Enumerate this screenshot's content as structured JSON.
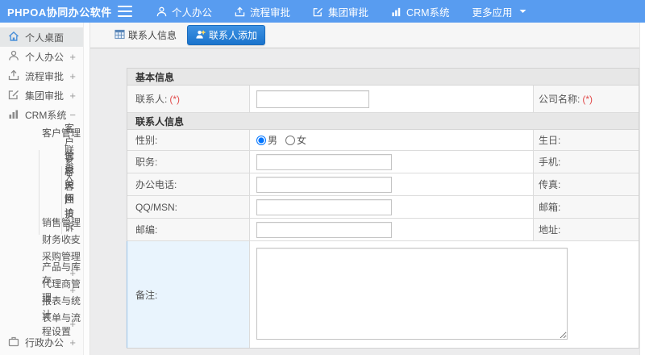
{
  "colors": {
    "topbar_blue": "#589cf0",
    "active_tab_blue": "#1b74cc",
    "required_red": "#e24c4c",
    "highlight_row": "#e9f4fd",
    "selected_sidebar": "#e5e7e8"
  },
  "topbar": {
    "brand": "PHPOA协同办公软件",
    "menu": [
      {
        "label": "个人办公",
        "icon": "user-icon"
      },
      {
        "label": "流程审批",
        "icon": "approval-icon"
      },
      {
        "label": "集团审批",
        "icon": "edit-icon"
      },
      {
        "label": "CRM系统",
        "icon": "chart-icon"
      },
      {
        "label": "更多应用",
        "icon": "caret-down-icon"
      }
    ]
  },
  "sidebar": {
    "items": [
      {
        "label": "个人桌面",
        "icon": "home-icon",
        "depth": 0,
        "selected": true,
        "toggle": ""
      },
      {
        "label": "个人办公",
        "icon": "user-icon",
        "depth": 0,
        "toggle": "+"
      },
      {
        "label": "流程审批",
        "icon": "approval-icon",
        "depth": 0,
        "toggle": "+"
      },
      {
        "label": "集团审批",
        "icon": "edit-icon",
        "depth": 0,
        "toggle": "+"
      },
      {
        "label": "CRM系统",
        "icon": "chart-icon",
        "depth": 0,
        "toggle": "−"
      },
      {
        "label": "客户管理",
        "depth": 1,
        "toggle": "−"
      },
      {
        "label": "客户信息",
        "depth": 2,
        "toggle": ""
      },
      {
        "label": "联系人",
        "depth": 2,
        "toggle": ""
      },
      {
        "label": "客户关怀",
        "depth": 2,
        "toggle": ""
      },
      {
        "label": "客户回访",
        "depth": 2,
        "toggle": ""
      },
      {
        "label": "客户投诉",
        "depth": 2,
        "toggle": ""
      },
      {
        "label": "销售管理",
        "depth": 1,
        "toggle": "+"
      },
      {
        "label": "财务收支",
        "depth": 1,
        "toggle": "+"
      },
      {
        "label": "采购管理",
        "depth": 1,
        "toggle": "+"
      },
      {
        "label": "产品与库存",
        "depth": 1,
        "toggle": "+"
      },
      {
        "label": "代理商管理",
        "depth": 1,
        "toggle": "+"
      },
      {
        "label": "报表与统计",
        "depth": 1,
        "toggle": ""
      },
      {
        "label": "表单与流程设置",
        "depth": 1,
        "toggle": "+"
      },
      {
        "label": "行政办公",
        "icon": "briefcase-icon",
        "depth": 0,
        "toggle": "+"
      }
    ]
  },
  "tabs": [
    {
      "label": "联系人信息",
      "icon": "grid-icon",
      "active": false
    },
    {
      "label": "联系人添加",
      "icon": "add-contact-icon",
      "active": true
    }
  ],
  "form": {
    "section1_title": "基本信息",
    "section2_title": "联系人信息",
    "row_contact": {
      "left": "联系人:",
      "left_req": "(*)",
      "right": "公司名称:",
      "right_req": "(*)",
      "input_value": ""
    },
    "row_gender": {
      "left": "性别:",
      "options": [
        "男",
        "女"
      ],
      "selected": "男",
      "right": "生日:"
    },
    "row_job": {
      "left": "职务:",
      "right": "手机:",
      "input_value": ""
    },
    "row_phone": {
      "left": "办公电话:",
      "right": "传真:",
      "input_value": ""
    },
    "row_qq": {
      "left": "QQ/MSN:",
      "right": "邮箱:",
      "input_value": ""
    },
    "row_zip": {
      "left": "邮编:",
      "right": "地址:",
      "input_value": ""
    },
    "row_note": {
      "left": "备注:",
      "textarea_value": ""
    }
  }
}
